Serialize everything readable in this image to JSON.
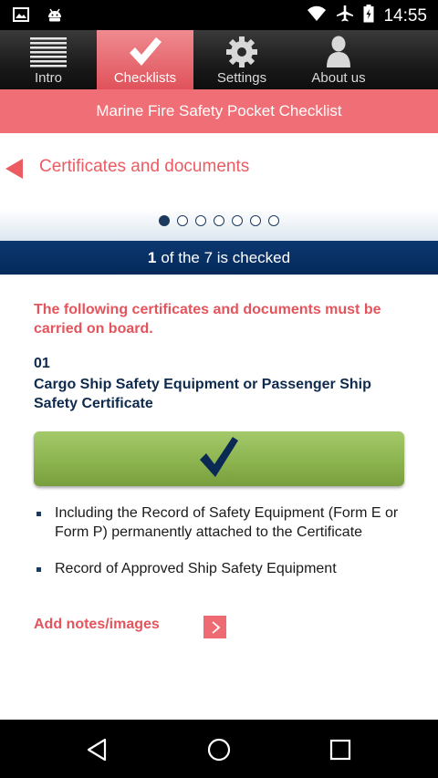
{
  "status_bar": {
    "time": "14:55",
    "left_icons": [
      "image-icon",
      "android-icon"
    ],
    "right_icons": [
      "wifi-icon",
      "airplane-icon",
      "battery-icon"
    ]
  },
  "tabs": [
    {
      "label": "Intro",
      "icon": "list-icon",
      "active": false
    },
    {
      "label": "Checklists",
      "icon": "check-icon",
      "active": true
    },
    {
      "label": "Settings",
      "icon": "gear-icon",
      "active": false
    },
    {
      "label": "About us",
      "icon": "person-icon",
      "active": false
    }
  ],
  "banner": {
    "title": "Marine Fire Safety Pocket Checklist"
  },
  "section": {
    "title": "Certificates and documents",
    "page_count": 7,
    "current_page": 1
  },
  "checked_status": {
    "count": "1",
    "text": "of the 7 is checked"
  },
  "content": {
    "intro": "The following certificates and documents must be carried on board.",
    "item_number": "01",
    "item_title": "Cargo Ship Safety Equipment or Passenger Ship Safety Certificate",
    "checked": true,
    "bullets": [
      "Including the Record of Safety Equipment (Form E or Form P) permanently attached to the Certificate",
      "Record of Approved Ship Safety Equipment"
    ],
    "add_notes_label": "Add notes/images"
  },
  "colors": {
    "accent": "#f06f76",
    "navy": "#0b3770",
    "check_green": "#8cb44f"
  },
  "nav_bar": {
    "buttons": [
      "back-icon",
      "home-icon",
      "recents-icon"
    ]
  }
}
